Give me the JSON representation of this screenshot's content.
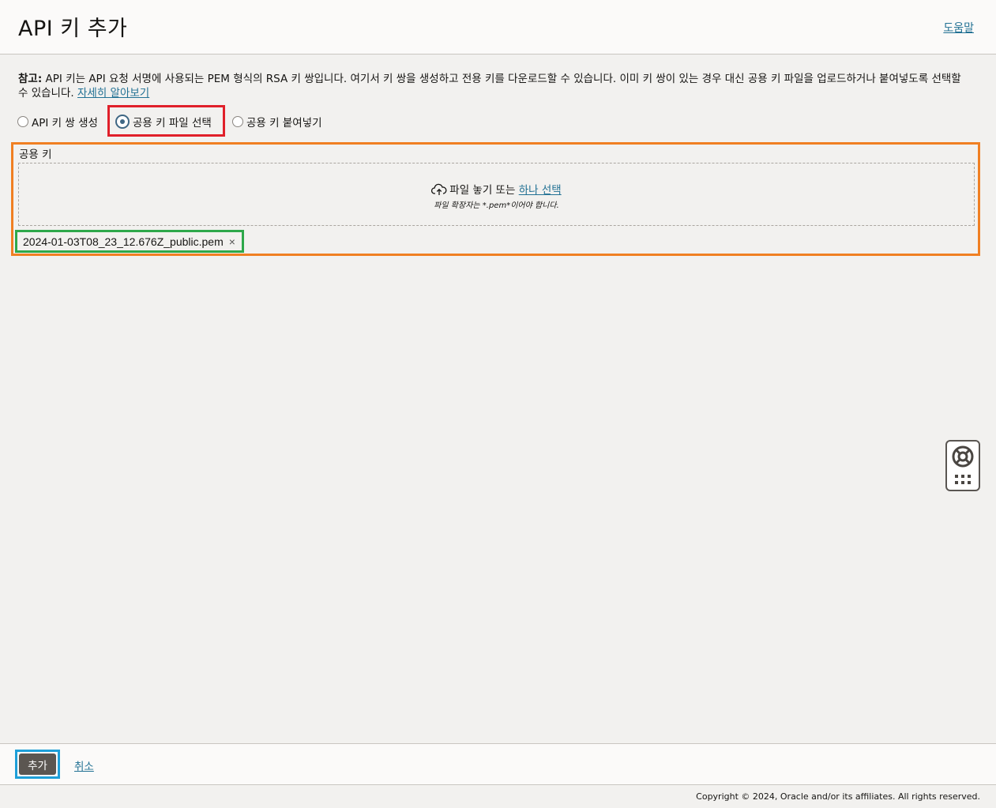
{
  "header": {
    "title": "API 키 추가",
    "help_label": "도움말"
  },
  "note": {
    "bold_label": "참고:",
    "text": " API 키는 API 요청 서명에 사용되는 PEM 형식의 RSA 키 쌍입니다. 여기서 키 쌍을 생성하고 전용 키를 다운로드할 수 있습니다. 이미 키 쌍이 있는 경우 대신 공용 키 파일을 업로드하거나 붙여넣도록 선택할 수 있습니다. ",
    "learn_more": "자세히 알아보기"
  },
  "key_options": [
    {
      "label": "API 키 쌍 생성",
      "selected": false
    },
    {
      "label": "공용 키 파일 선택",
      "selected": true
    },
    {
      "label": "공용 키 붙여넣기",
      "selected": false
    }
  ],
  "public_key": {
    "label": "공용 키",
    "drop_text": "파일 놓기 또는",
    "select_link": "하나 선택",
    "hint": "파일 확장자는 *.pem*이어야 합니다.",
    "file_name": "2024-01-03T08_23_12.676Z_public.pem",
    "remove_symbol": "×"
  },
  "footer": {
    "add_label": "추가",
    "cancel_label": "취소",
    "copyright": "Copyright © 2024, Oracle and/or its affiliates. All rights reserved."
  },
  "colors": {
    "link": "#227194",
    "primary_button": "#5b5651",
    "highlight_red": "#e0202a",
    "highlight_orange": "#f07f22",
    "highlight_green": "#2ea84a",
    "highlight_blue": "#1e9fd8"
  },
  "icons": {
    "upload": "cloud-upload-icon",
    "helper": "lifebuoy-icon",
    "grid": "grid-dots-icon"
  }
}
